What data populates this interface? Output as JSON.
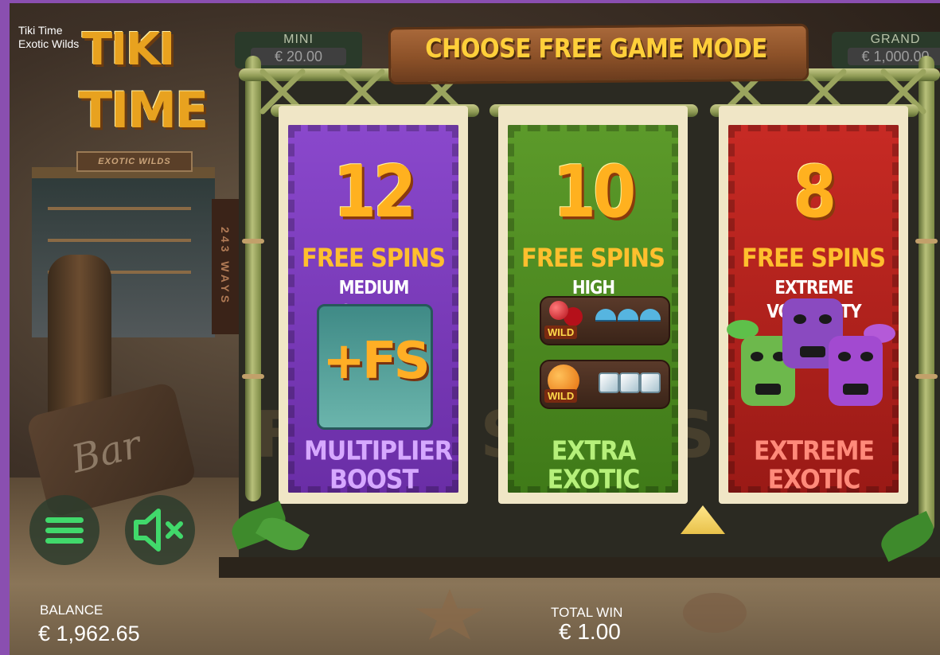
{
  "game": {
    "title": "Tiki Time Exotic Wilds"
  },
  "logo": {
    "line1": "TIKI",
    "line2": "TIME",
    "subtitle": "EXOTIC WILDS"
  },
  "ways": "243 WAYS",
  "jackpots": [
    {
      "label": "MINI",
      "value": "€ 20.00"
    },
    {
      "label": "GRAND",
      "value": "€ 1,000.00"
    }
  ],
  "banner": "CHOOSE FREE GAME MODE",
  "modes": [
    {
      "number": "12",
      "spins_label": "FREE SPINS",
      "volatility": "MEDIUM VOLATILITY",
      "feature_icon": "+FS",
      "feature": "MULTIPLIER BOOST",
      "color": "#7c3cb8",
      "feature_color": "#d6a8ff"
    },
    {
      "number": "10",
      "spins_label": "FREE SPINS",
      "volatility": "HIGH VOLATILITY",
      "wild_tag": "WILD",
      "feature": "EXTRA EXOTIC",
      "color": "#4e8a22",
      "feature_color": "#b6f07a"
    },
    {
      "number": "8",
      "spins_label": "FREE SPINS",
      "volatility": "EXTREME VOLATILITY",
      "feature": "EXTREME EXOTIC",
      "color": "#b3221e",
      "feature_color": "#ff8a7a"
    }
  ],
  "reel_background_text": "FREE SPINS",
  "bar_sign": "Bar",
  "controls": {
    "menu_icon": "hamburger-menu-icon",
    "sound_icon": "speaker-muted-icon"
  },
  "balance": {
    "label": "BALANCE",
    "value": "€ 1,962.65"
  },
  "total_win": {
    "label": "TOTAL WIN",
    "value": "€ 1.00"
  },
  "colors": {
    "accent_green": "#41d96b",
    "banner_text": "#ffcf3a",
    "number_gold": "#ffb11f"
  }
}
